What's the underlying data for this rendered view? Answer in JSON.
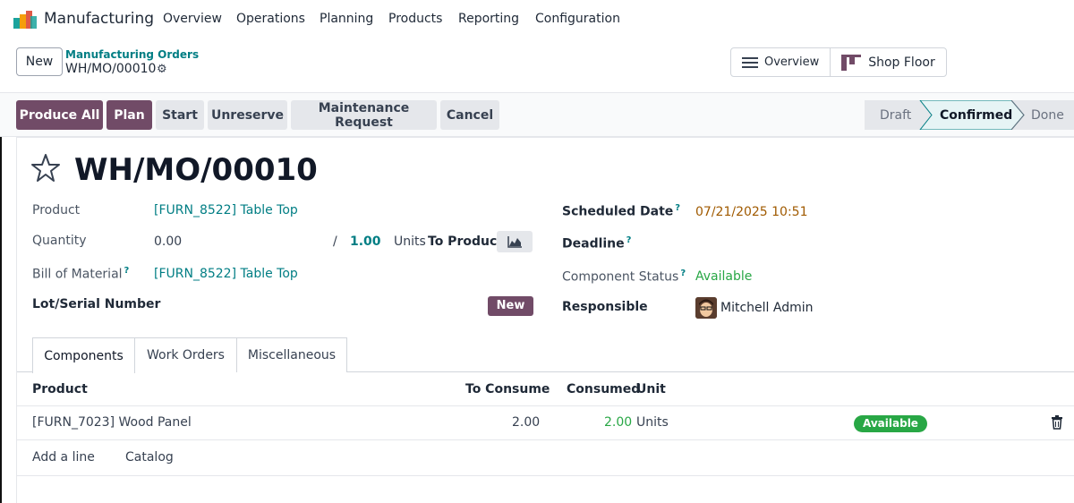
{
  "navbar": {
    "app_name": "Manufacturing",
    "menu": [
      "Overview",
      "Operations",
      "Planning",
      "Products",
      "Reporting",
      "Configuration"
    ]
  },
  "control_panel": {
    "new_label": "New",
    "breadcrumb_parent": "Manufacturing Orders",
    "breadcrumb_current": "WH/MO/00010",
    "views": [
      "Overview",
      "Shop Floor"
    ]
  },
  "actions": {
    "buttons": [
      "Produce All",
      "Plan",
      "Start",
      "Unreserve",
      "Maintenance Request",
      "Cancel"
    ],
    "stages": [
      "Draft",
      "Confirmed",
      "Done"
    ],
    "active_stage": "Confirmed"
  },
  "form": {
    "title": "WH/MO/00010",
    "product_label": "Product",
    "product_value": "[FURN_8522] Table Top",
    "quantity_label": "Quantity",
    "quantity_produced": "0.00",
    "quantity_sep": "/",
    "quantity_total": "1.00",
    "quantity_uom": "Units",
    "quantity_suffix": "To Produce",
    "bom_label": "Bill of Material",
    "bom_value": "[FURN_8522] Table Top",
    "lot_label": "Lot/Serial Number",
    "lot_new": "New",
    "scheduled_label": "Scheduled Date",
    "scheduled_value": "07/21/2025 10:51",
    "deadline_label": "Deadline",
    "component_status_label": "Component Status",
    "component_status_value": "Available",
    "responsible_label": "Responsible",
    "responsible_value": "Mitchell Admin",
    "help_mark": "?"
  },
  "tabs": [
    "Components",
    "Work Orders",
    "Miscellaneous"
  ],
  "components_table": {
    "headers": [
      "Product",
      "To Consume",
      "Consumed",
      "Unit"
    ],
    "rows": [
      {
        "product": "[FURN_7023] Wood Panel",
        "to_consume": "2.00",
        "consumed": "2.00",
        "unit": "Units",
        "status": "Available"
      }
    ],
    "add_line": "Add a line",
    "catalog": "Catalog"
  },
  "colors": {
    "primary": "#714b67",
    "link": "#017e84",
    "success": "#28a745",
    "date": "#a05a00"
  }
}
